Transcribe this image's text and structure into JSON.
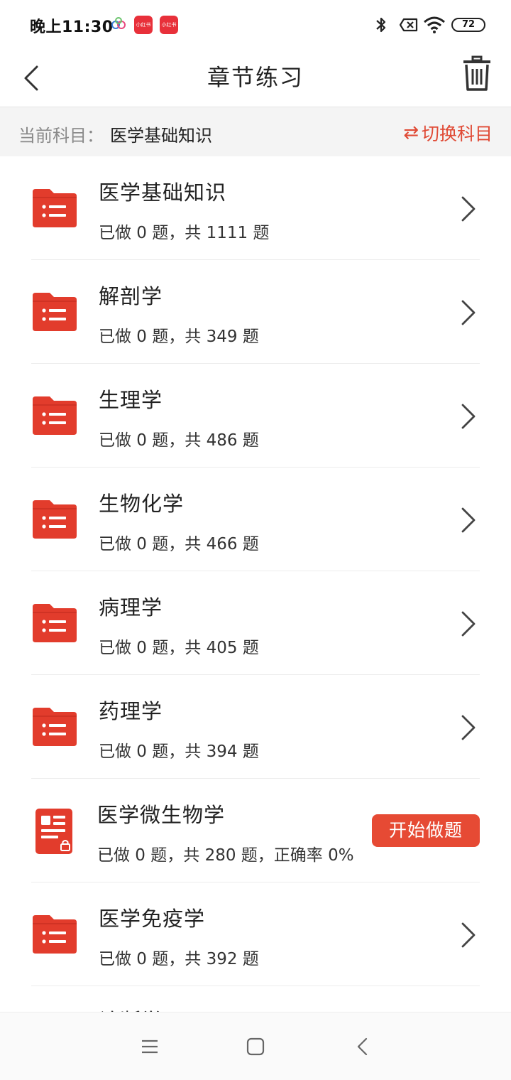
{
  "status_bar": {
    "time": "晚上11:30",
    "app_badge_1": "小红书",
    "app_badge_2": "小红书",
    "battery": "72"
  },
  "header": {
    "title": "章节练习"
  },
  "subject_bar": {
    "label": "当前科目：",
    "value": "医学基础知识",
    "switch_label": "切换科目",
    "switch_icon": "⇄"
  },
  "chapters": [
    {
      "title": "医学基础知识",
      "subtitle": "已做 0 题，共 1111 题"
    },
    {
      "title": "解剖学",
      "subtitle": "已做 0 题，共 349 题"
    },
    {
      "title": "生理学",
      "subtitle": "已做 0 题，共 486 题"
    },
    {
      "title": "生物化学",
      "subtitle": "已做 0 题，共 466 题"
    },
    {
      "title": "病理学",
      "subtitle": "已做 0 题，共 405 题"
    },
    {
      "title": "药理学",
      "subtitle": "已做 0 题，共 394 题"
    },
    {
      "title": "医学微生物学",
      "subtitle": "已做 0 题，共 280 题，正确率 0%",
      "action_label": "开始做题"
    },
    {
      "title": "医学免疫学",
      "subtitle": "已做 0 题，共 392 题"
    },
    {
      "title": "诊断学"
    }
  ],
  "colors": {
    "accent": "#e64a34",
    "folder": "#e23c2c",
    "subject_bar_bg": "#f4f4f4"
  },
  "icons": {
    "back": "chevron-left-icon",
    "trash": "trash-icon",
    "folder": "folder-list-icon",
    "locked_doc": "locked-document-icon",
    "arrow": "chevron-right-icon"
  }
}
